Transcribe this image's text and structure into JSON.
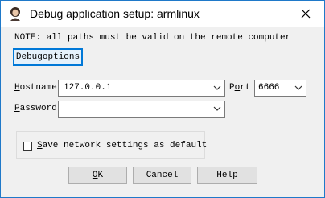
{
  "window": {
    "title": "Debug application setup: armlinux"
  },
  "note": "NOTE: all paths must be valid on the remote computer",
  "debug_options": {
    "label": "Debug options",
    "accel_prefix": "Debug ",
    "accel_char": "o",
    "accel_suffix": "ptions"
  },
  "hostname": {
    "label_prefix": "",
    "label_accel": "H",
    "label_suffix": "ostname",
    "value": "127.0.0.1"
  },
  "port": {
    "label_prefix": "P",
    "label_accel": "o",
    "label_suffix": "rt",
    "value": "6666"
  },
  "password": {
    "label_prefix": "",
    "label_accel": "P",
    "label_suffix": "assword",
    "value": ""
  },
  "save_settings": {
    "label_accel": "S",
    "label_rest": "ave network settings as default",
    "checked": false
  },
  "buttons": {
    "ok": {
      "accel": "O",
      "rest": "K"
    },
    "cancel": "Cancel",
    "help": "Help"
  },
  "icons": {
    "app": "user-avatar-icon",
    "close": "close-icon",
    "dropdown": "chevron-down-icon"
  },
  "colors": {
    "accent": "#0078d7",
    "window_border": "#1f79c9",
    "dialog_bg": "#f0f0f0"
  }
}
